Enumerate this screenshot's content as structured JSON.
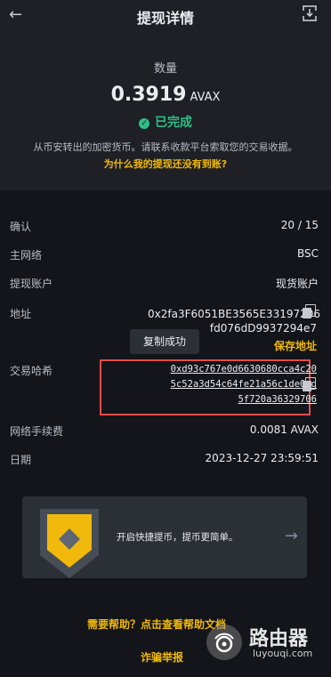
{
  "header": {
    "title": "提现详情",
    "back_icon": "back-arrow-icon",
    "share_icon": "share-icon"
  },
  "summary": {
    "amount_label": "数量",
    "amount_value": "0.3919",
    "amount_unit": "AVAX",
    "status_text": "已完成",
    "status_color": "#2ebd85",
    "note": "从币安转出的加密货币。请联系收款平台索取您的交易收据。",
    "why_link": "为什么我的提现还没有到账?"
  },
  "details": {
    "confirm": {
      "label": "确认",
      "value": "20 / 15"
    },
    "network": {
      "label": "主网络",
      "value": "BSC"
    },
    "account": {
      "label": "提现账户",
      "value": "现货账户"
    },
    "address": {
      "label": "地址",
      "line1": "0x2fa3F6051BE3565E33197206",
      "line2": "fd076dD9937294e7",
      "save_label": "保存地址"
    },
    "toast": "复制成功",
    "txhash": {
      "label": "交易哈希",
      "line1": "0xd93c767e0d6630680cca4c20",
      "line2": "5c52a3d54c64fe21a56c1de0cd",
      "line3": "5f720a36329706"
    },
    "fee": {
      "label": "网络手续费",
      "value": "0.0081 AVAX"
    },
    "date": {
      "label": "日期",
      "value": "2023-12-27 23:59:51"
    }
  },
  "banner": {
    "text": "开启快捷提币，提币更简单。",
    "arrow_icon": "arrow-right-icon"
  },
  "footer": {
    "help_link": "需要帮助？点击查看帮助文档",
    "scam_link": "诈骗举报"
  },
  "watermark": {
    "name": "路由器",
    "url": "luyouqi.com"
  },
  "colors": {
    "accent": "#f0b90b",
    "background": "#14151a",
    "panel": "#1e2026",
    "highlight_border": "#e24b4b"
  }
}
